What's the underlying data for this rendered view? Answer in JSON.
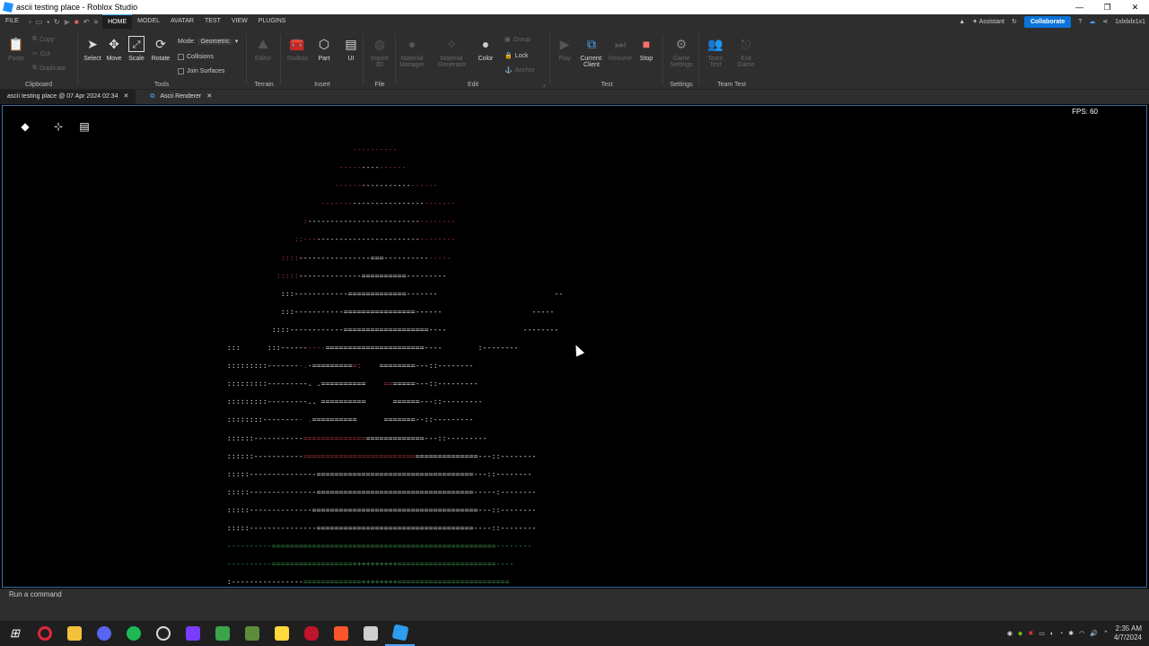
{
  "window": {
    "title": "ascii testing place - Roblox Studio",
    "controls": [
      "—",
      "❐",
      "✕"
    ]
  },
  "menu": {
    "file": "FILE",
    "tabs": [
      "HOME",
      "MODEL",
      "AVATAR",
      "TEST",
      "VIEW",
      "PLUGINS"
    ],
    "assistant": "Assistant",
    "collaborate": "Collaborate",
    "user": "1xlxlxlx1x1"
  },
  "ribbon": {
    "clipboard": {
      "label": "Clipboard",
      "paste": "Paste",
      "copy": "Copy",
      "cut": "Cut",
      "duplicate": "Duplicate"
    },
    "tools": {
      "label": "Tools",
      "select": "Select",
      "move": "Move",
      "scale": "Scale",
      "rotate": "Rotate",
      "mode_label": "Mode:",
      "mode_value": "Geometric",
      "collisions": "Collisions",
      "join_surfaces": "Join Surfaces"
    },
    "terrain": {
      "label": "Terrain",
      "editor": "Editor"
    },
    "insert": {
      "label": "Insert",
      "toolbox": "Toolbox",
      "part": "Part",
      "ui": "UI"
    },
    "file": {
      "label": "File",
      "import3d": "Import 3D"
    },
    "edit": {
      "label": "Edit",
      "material_manager": "Material Manager",
      "material_generator": "Material Generator",
      "color": "Color",
      "group": "Group",
      "lock": "Lock",
      "anchor": "Anchor"
    },
    "test": {
      "label": "Test",
      "play": "Play",
      "current_client": "Current: Client",
      "resume": "Resume",
      "stop": "Stop"
    },
    "settings": {
      "label": "Settings",
      "game_settings": "Game Settings"
    },
    "team_test": {
      "label": "Team Test",
      "team_test": "Team Test",
      "exit_game": "Exit Game"
    }
  },
  "doc_tabs": [
    {
      "label": "ascii testing place @ 07 Apr 2024 02:34"
    },
    {
      "label": "Ascii Renderer"
    }
  ],
  "viewport": {
    "fps": "FPS: 60"
  },
  "ascii_lines": [
    {
      "segs": [
        [
          "                                                                              ",
          ""
        ],
        [
          "----------",
          "r"
        ]
      ]
    },
    {
      "segs": [
        [
          "                                                                           ",
          ""
        ],
        [
          "-----",
          "r"
        ],
        [
          "----",
          "w"
        ],
        [
          "------",
          "r"
        ]
      ]
    },
    {
      "segs": [
        [
          "                                                                          ",
          ""
        ],
        [
          "------",
          "r"
        ],
        [
          "-----------",
          "w"
        ],
        [
          "------",
          "r"
        ]
      ]
    },
    {
      "segs": [
        [
          "                                                                       ",
          ""
        ],
        [
          "-------",
          "r"
        ],
        [
          "----------------",
          "w"
        ],
        [
          "-------",
          "r"
        ]
      ]
    },
    {
      "segs": [
        [
          "                                                                   ",
          ""
        ],
        [
          ":",
          "r"
        ],
        [
          "-------------------------",
          "w"
        ],
        [
          "--------",
          "r"
        ]
      ]
    },
    {
      "segs": [
        [
          "                                                                 ",
          ""
        ],
        [
          "::",
          "r"
        ],
        [
          "---",
          "r"
        ],
        [
          "-----------------------",
          "w"
        ],
        [
          "--------",
          "r"
        ]
      ]
    },
    {
      "segs": [
        [
          "                                                              ",
          ""
        ],
        [
          "::::",
          "r"
        ],
        [
          "----------------===----------",
          "w"
        ],
        [
          "-----",
          "r"
        ]
      ]
    },
    {
      "segs": [
        [
          "                                                             ",
          ""
        ],
        [
          ":::::",
          "r"
        ],
        [
          "--------------==========---------",
          "w"
        ]
      ]
    },
    {
      "segs": [
        [
          "                                                              ",
          ""
        ],
        [
          ":::",
          "w"
        ],
        [
          "------------=============-------",
          "w"
        ],
        [
          "                          --",
          "w"
        ]
      ]
    },
    {
      "segs": [
        [
          "                                                              ",
          ""
        ],
        [
          ":::",
          "w"
        ],
        [
          "-----------================------",
          "w"
        ],
        [
          "                    -----",
          "w"
        ]
      ]
    },
    {
      "segs": [
        [
          "                                                            ",
          ""
        ],
        [
          "::::",
          "w"
        ],
        [
          "------------===================----",
          "w"
        ],
        [
          "                 --------",
          "w"
        ]
      ]
    },
    {
      "segs": [
        [
          "                                                  ",
          ""
        ],
        [
          ":::      :::",
          "w"
        ],
        [
          "------",
          "w"
        ],
        [
          "----",
          "r"
        ],
        [
          "======================----",
          "w"
        ],
        [
          "        :--------",
          "w"
        ]
      ]
    },
    {
      "segs": [
        [
          "                                                  ",
          ""
        ],
        [
          ":::::::::-------",
          "w"
        ],
        [
          "-.",
          "r"
        ],
        [
          "-=========",
          "w"
        ],
        [
          "=:",
          "r"
        ],
        [
          "    ========---::--------",
          "w"
        ]
      ]
    },
    {
      "segs": [
        [
          "                                                  ",
          ""
        ],
        [
          ":::::::::---------. .==========",
          "w"
        ],
        [
          "    ",
          "w"
        ],
        [
          "==",
          "r"
        ],
        [
          "=====---::---------",
          "w"
        ]
      ]
    },
    {
      "segs": [
        [
          "                                                  ",
          ""
        ],
        [
          ":::::::::---------.. ==========",
          "w"
        ],
        [
          "      ======---::---------",
          "w"
        ]
      ]
    },
    {
      "segs": [
        [
          "                                                  ",
          ""
        ],
        [
          "::::::::--------",
          "w"
        ],
        [
          "- .",
          "r"
        ],
        [
          "==========",
          "w"
        ],
        [
          "      =======--::---------",
          "w"
        ]
      ]
    },
    {
      "segs": [
        [
          "                                                  ",
          ""
        ],
        [
          "::::::-----------",
          "w"
        ],
        [
          "==============",
          "r"
        ],
        [
          "=============---::---------",
          "w"
        ]
      ]
    },
    {
      "segs": [
        [
          "                                                  ",
          ""
        ],
        [
          "::::::-----------",
          "w"
        ],
        [
          "=========================",
          "r"
        ],
        [
          "==============---::--------",
          "w"
        ]
      ]
    },
    {
      "segs": [
        [
          "                                                  ",
          ""
        ],
        [
          ":::::---------------===================================---::--------",
          "w"
        ]
      ]
    },
    {
      "segs": [
        [
          "                                                  ",
          ""
        ],
        [
          ":::::---------------===================================-----:--------",
          "w"
        ]
      ]
    },
    {
      "segs": [
        [
          "                                                  ",
          ""
        ],
        [
          ":::::--------------=====================================---::--------",
          "w"
        ]
      ]
    },
    {
      "segs": [
        [
          "                                                  ",
          ""
        ],
        [
          ":::::---------------===================================----::--------",
          "w"
        ]
      ]
    },
    {
      "segs": [
        [
          "                                                  ",
          ""
        ],
        [
          "----------==================================================--------",
          "g"
        ]
      ]
    },
    {
      "segs": [
        [
          "                                                  ",
          ""
        ],
        [
          "----------==================",
          "g"
        ],
        [
          "++++++++++",
          "g"
        ],
        [
          "======================----",
          "g"
        ]
      ]
    },
    {
      "segs": [
        [
          "                                                  ",
          ""
        ],
        [
          ":----------------",
          "w"
        ],
        [
          "=============",
          "g"
        ],
        [
          "++++++++",
          "g"
        ],
        [
          "=========================",
          "g"
        ]
      ]
    }
  ],
  "command_bar": {
    "placeholder": "Run a command"
  },
  "clock": {
    "time": "2:35 AM",
    "date": "4/7/2024"
  },
  "taskbar_apps": [
    "windows-start",
    "opera",
    "file-explorer",
    "discord",
    "spotify",
    "app-obs",
    "app-purple",
    "minecraft",
    "app-green",
    "sticky-notes",
    "app-red",
    "brave",
    "app-gray",
    "roblox-studio"
  ]
}
